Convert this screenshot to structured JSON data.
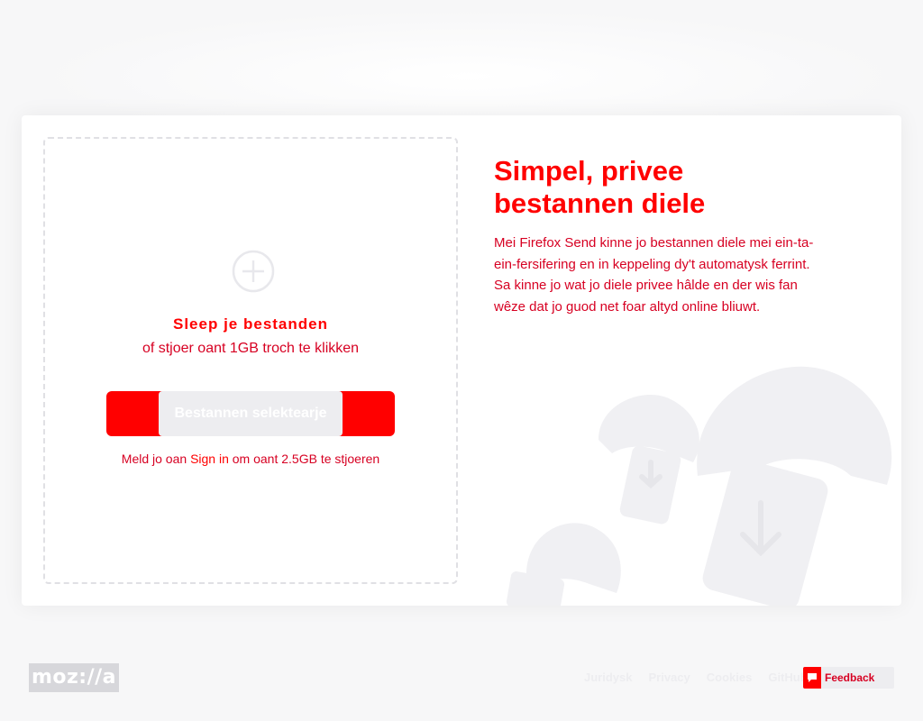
{
  "dropzone": {
    "title": "Sleep je bestanden",
    "subtitle": "of stjoer oant 1GB troch te klikken",
    "upload_button_label": "Bestannen selektearje",
    "signin_prefix": "Meld jo oan",
    "signin_link": "Sign in",
    "signin_suffix": " om oant 2.5GB te stjoeren"
  },
  "intro": {
    "title_line1": "Simpel, privee",
    "title_line2": "bestannen diele",
    "description": "Mei Firefox Send kinne jo bestannen diele mei ein-ta-ein-fersifering en in keppeling dy't automatysk ferrint. Sa kinne jo wat jo diele privee hâlde en der wis fan wêze dat jo guod net foar altyd online bliuwt."
  },
  "footer": {
    "logo_text": "moz://a",
    "links": [
      "Juridysk",
      "Privacy",
      "Cookies",
      "GitHub"
    ],
    "feedback_label": "Feedback"
  },
  "colors": {
    "accent": "#ff0000",
    "accent_dark": "#d70022",
    "page_bg": "#f7f7f8",
    "illustration_gray": "#ededf0"
  }
}
